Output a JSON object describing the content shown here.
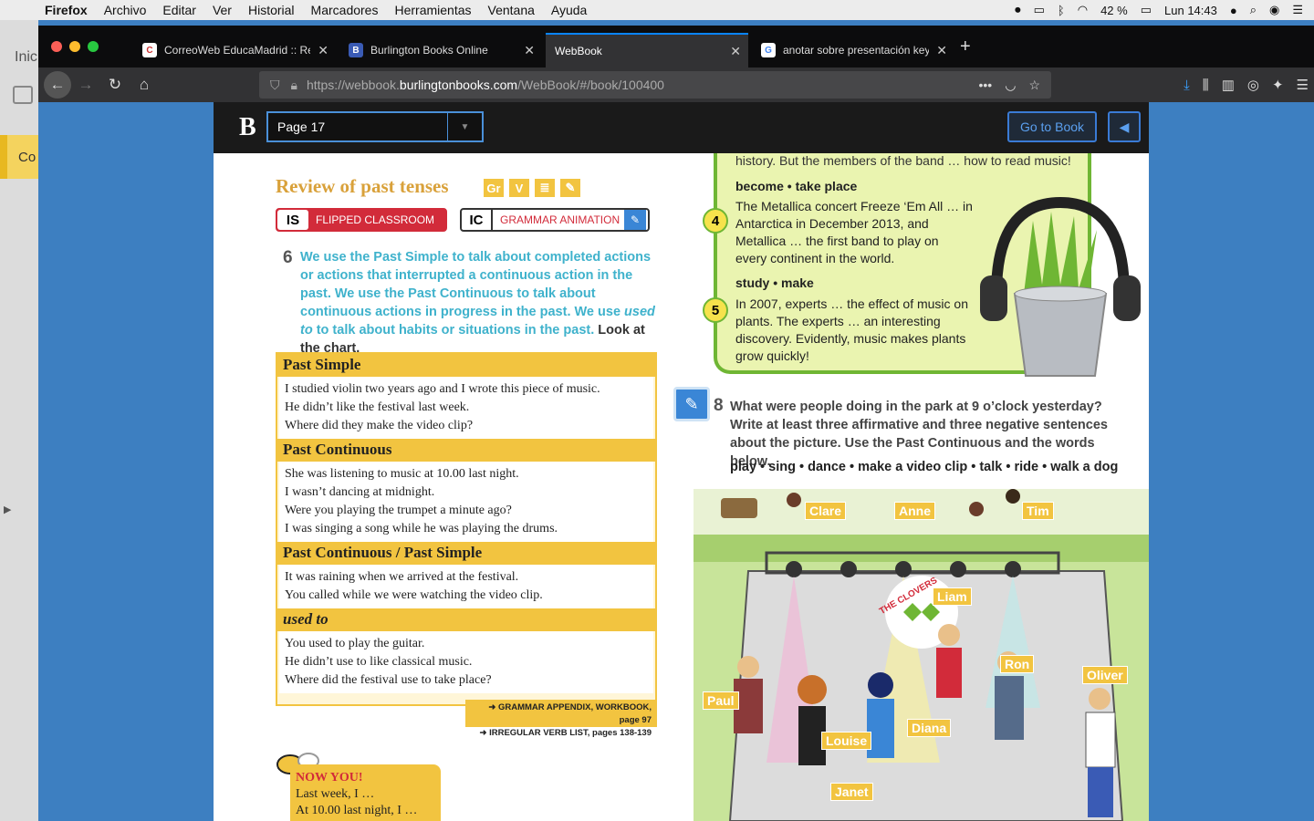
{
  "menubar": {
    "app": "Firefox",
    "items": [
      "Archivo",
      "Editar",
      "Ver",
      "Historial",
      "Marcadores",
      "Herramientas",
      "Ventana",
      "Ayuda"
    ],
    "battery": "42 %",
    "clock": "Lun 14:43"
  },
  "bg_window": {
    "label_top": "Inic",
    "label_bottom": "Co"
  },
  "tabs": [
    {
      "label": "CorreoWeb EducaMadrid :: Red",
      "fav": "C"
    },
    {
      "label": "Burlington Books Online",
      "fav": "B"
    },
    {
      "label": "WebBook",
      "fav": ""
    },
    {
      "label": "anotar sobre presentación key",
      "fav": "G"
    }
  ],
  "url": {
    "prefix": "https://webbook.",
    "host": "burlingtonbooks.com",
    "path": "/WebBook/#/book/100400"
  },
  "webbook": {
    "page_select": "Page 17",
    "goto_label": "Go to Book"
  },
  "left": {
    "title": "Review of past tenses",
    "badges": [
      "Gr",
      "V",
      "≣",
      "✎"
    ],
    "flipped": {
      "icon": "IS",
      "label": "FLIPPED CLASSROOM"
    },
    "grammar": {
      "icon": "IC",
      "label": "GRAMMAR ANIMATION"
    },
    "ex6_num": "6",
    "ex6_a": "We use the Past Simple to talk about completed actions or actions that interrupted a continuous action in the past. We use the Past Continuous to talk about continuous actions in progress in the past. We use ",
    "ex6_b": "used to",
    "ex6_c": " to talk about habits or situations in the past.",
    "ex6_d": " Look at the chart.",
    "chart": [
      {
        "head": "Past Simple",
        "lines": [
          "I studied violin two years ago and I wrote this piece of music.",
          "He didn’t like the festival last week.",
          "Where did they make the video clip?"
        ]
      },
      {
        "head": "Past Continuous",
        "lines": [
          "She was listening to music at 10.00 last night.",
          "I wasn’t dancing at midnight.",
          "Were you playing the trumpet a minute ago?",
          "I was singing a song while he was playing the drums."
        ]
      },
      {
        "head": "Past Continuous / Past Simple",
        "lines": [
          "It was raining when we arrived at the festival.",
          "You called while we were watching the video clip."
        ]
      },
      {
        "head": "used to",
        "lines": [
          "You used to play the guitar.",
          "He didn’t use to like classical music.",
          "Where did the festival use to take place?"
        ]
      }
    ],
    "appendix1": "➜ GRAMMAR APPENDIX, WORKBOOK, page 97",
    "appendix2": "➜ IRREGULAR VERB LIST, pages 138-139",
    "nowyou": {
      "head": "NOW YOU!",
      "l1": "Last week, I …",
      "l2": "At 10.00 last night, I …"
    }
  },
  "right": {
    "top_line": "history. But the members of the band … how to read music!",
    "item4": {
      "num": "4",
      "head": "become • take place",
      "text": "The Metallica concert Freeze ‘Em All … in Antarctica in December 2013, and Metallica … the first band to play on every continent in the world."
    },
    "item5": {
      "num": "5",
      "head": "study • make",
      "text": "In 2007, experts … the effect of music on plants. The experts … an interesting discovery. Evidently, music makes plants grow quickly!"
    },
    "ex8_num": "8",
    "ex8_text": "What were people doing in the park at 9 o’clock yesterday? Write at least three affirmative and three negative sentences about the picture. Use the Past Continuous and the words below.",
    "ex8_words": "play • sing • dance • make a video clip • talk • ride • walk a dog",
    "names": [
      "Clare",
      "Anne",
      "Tim",
      "Liam",
      "Ron",
      "Oliver",
      "Paul",
      "Louise",
      "Diana",
      "Janet"
    ],
    "band_sign": "THE CLOVERS"
  }
}
